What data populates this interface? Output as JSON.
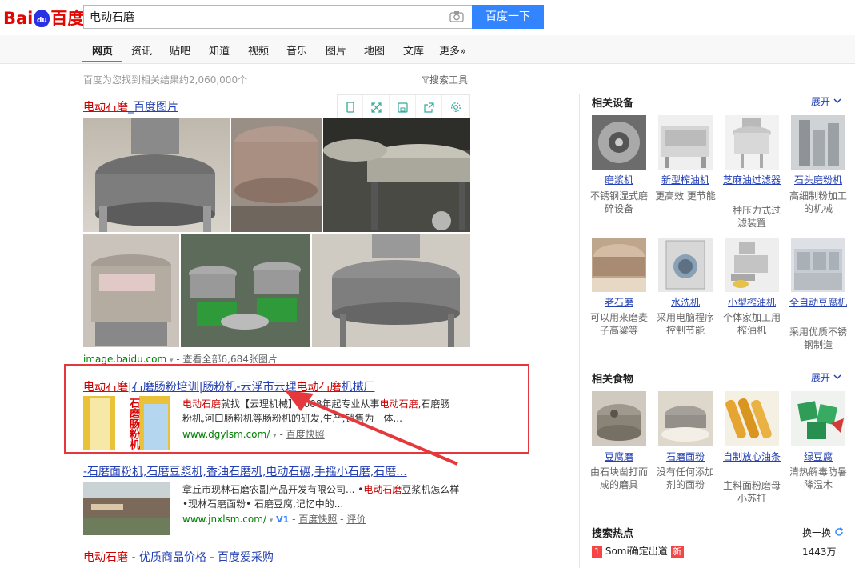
{
  "header": {
    "logo_text_left": "Bai",
    "logo_paw_text": "du",
    "logo_text_right": "百度",
    "search_value": "电动石磨",
    "search_button": "百度一下"
  },
  "tabs": [
    "网页",
    "资讯",
    "贴吧",
    "知道",
    "视频",
    "音乐",
    "图片",
    "地图",
    "文库",
    "更多»"
  ],
  "result_count": "百度为您找到相关结果约2,060,000个",
  "search_tools": "搜索工具",
  "image_result": {
    "title_em": "电动石磨",
    "title_rest": "_百度图片",
    "source": "image.baidu.com",
    "more": "- 查看全部6,684张图片"
  },
  "result1": {
    "title_em1": "电动石磨",
    "title_mid": "|石磨肠粉培训|肠粉机-云浮市云理",
    "title_em2": "电动石磨",
    "title_end": "机械厂",
    "thumb_text": "石磨肠粉机",
    "snippet_em1": "电动石磨",
    "snippet_1": "就找【云理机械】2008年起专业从事",
    "snippet_em2": "电动石磨",
    "snippet_2": ",石磨肠粉机,河口肠粉机等肠粉机的研发,生产,销售为一体...",
    "url": "www.dgylsm.com/",
    "cache": "百度快照"
  },
  "result2": {
    "title": "-石磨面粉机,石磨豆浆机,香油石磨机,电动石碾,手摇小石磨,石磨...",
    "snippet_1": "章丘市现林石磨农副产品开发有限公司... •",
    "snippet_em": "电动石磨",
    "snippet_2": "豆浆机怎么样•现林石磨面粉• 石磨豆腐,记忆中的...",
    "url": "www.jnxlsm.com/",
    "v_badge": "V1",
    "cache": "百度快照",
    "review": "评价"
  },
  "result3": {
    "title_em": "电动石磨",
    "title_rest": " - 优质商品价格 - 百度爱采购"
  },
  "related_equipment": {
    "heading": "相关设备",
    "expand": "展开",
    "items": [
      {
        "name": "磨浆机",
        "desc": "不锈钢湿式磨碎设备"
      },
      {
        "name": "新型榨油机",
        "desc": "更高效 更节能"
      },
      {
        "name": "芝麻油过滤器",
        "desc": "一种压力式过滤装置"
      },
      {
        "name": "石头磨粉机",
        "desc": "高细制粉加工的机械"
      },
      {
        "name": "老石磨",
        "desc": "可以用来磨麦子高粱等"
      },
      {
        "name": "水洗机",
        "desc": "采用电脑程序控制节能"
      },
      {
        "name": "小型榨油机",
        "desc": "个体家加工用榨油机"
      },
      {
        "name": "全自动豆腐机",
        "desc": "采用优质不锈钢制造"
      }
    ]
  },
  "related_food": {
    "heading": "相关食物",
    "expand": "展开",
    "items": [
      {
        "name": "豆腐磨",
        "desc": "由石块凿打而成的磨具"
      },
      {
        "name": "石磨面粉",
        "desc": "没有任何添加剂的面粉"
      },
      {
        "name": "自制放心油条",
        "desc": "主料面粉磨母小苏打"
      },
      {
        "name": "绿豆腐",
        "desc": "清热解毒防暑降温木"
      }
    ]
  },
  "hot_search": {
    "heading": "搜索热点",
    "refresh": "换一换",
    "items": [
      {
        "rank": "1",
        "text": "Somi确定出道",
        "badge": "新",
        "count": "1443万"
      }
    ]
  },
  "colors": {
    "accent": "#3385ff",
    "link": "#2440b3",
    "highlight": "#c00000",
    "annotation": "#e5383d"
  }
}
